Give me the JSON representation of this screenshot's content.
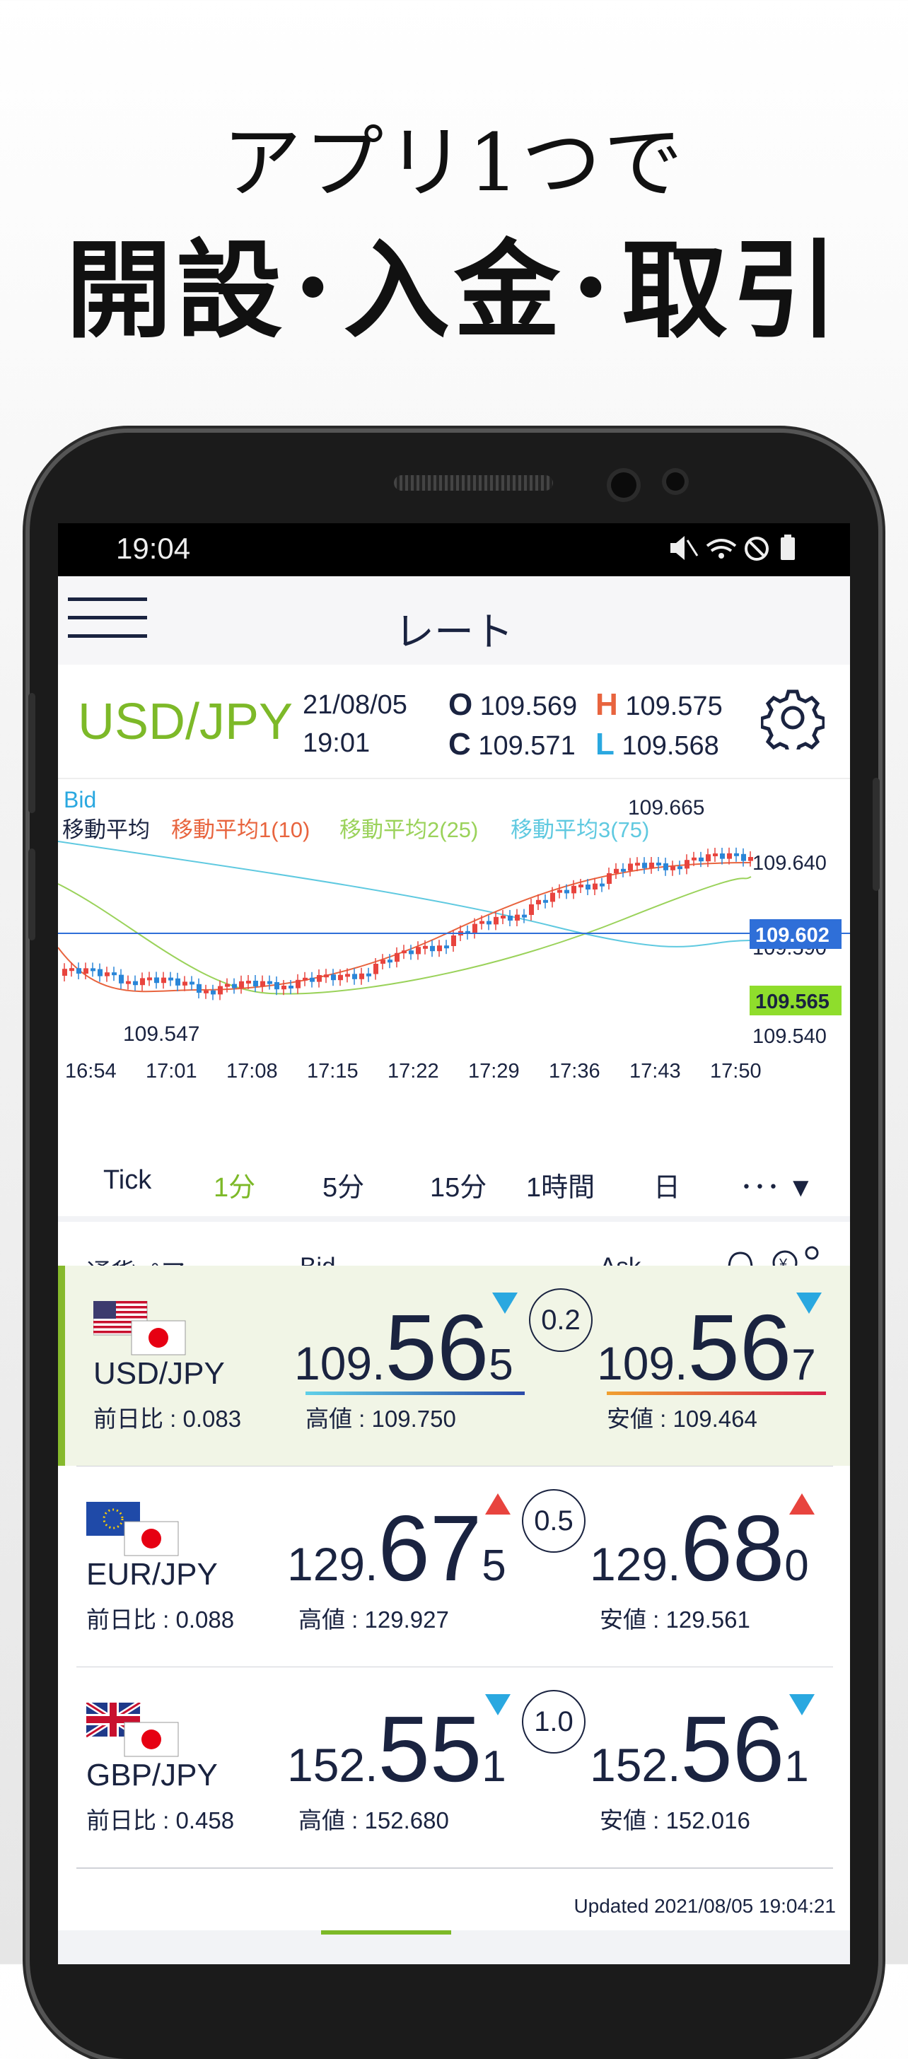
{
  "headline": {
    "line1": "アプリ1つで",
    "line2": "開設･入金･取引"
  },
  "status": {
    "time": "19:04",
    "icons": "mute-icon wifi-icon dnd-icon battery-icon"
  },
  "nav": {
    "title": "レート"
  },
  "pair_header": {
    "pair": "USD/JPY",
    "date": "21/08/05",
    "time": "19:01",
    "open_label": "O",
    "open": "109.569",
    "high_label": "H",
    "high": "109.575",
    "close_label": "C",
    "close": "109.571",
    "low_label": "L",
    "low": "109.568"
  },
  "chart_data": {
    "type": "candlestick",
    "series_label": "Bid",
    "legend": [
      "移動平均",
      "移動平均1(10)",
      "移動平均2(25)",
      "移動平均3(75)"
    ],
    "legend_colors": [
      "#1a2340",
      "#e8643e",
      "#9ad25a",
      "#5fc9e0"
    ],
    "x_ticks": [
      "16:54",
      "17:01",
      "17:08",
      "17:15",
      "17:22",
      "17:29",
      "17:36",
      "17:43",
      "17:50"
    ],
    "y_ticks": [
      "109.640",
      "109.590",
      "109.540"
    ],
    "ylim": [
      109.53,
      109.67
    ],
    "max_label": "109.665",
    "min_label": "109.547",
    "ask_line": "109.602",
    "bid_tag": "109.565"
  },
  "timeframes": [
    "Tick",
    "1分",
    "5分",
    "15分",
    "1時間",
    "日",
    "･･･ ▼"
  ],
  "list_header": {
    "pair": "通貨ペア",
    "bid": "Bid",
    "ask": "Ask"
  },
  "rows": [
    {
      "pair": "USD/JPY",
      "change": "前日比 : 0.083",
      "bid_pre": "109.",
      "bid_big": "56",
      "bid_pip": "5",
      "spread": "0.2",
      "ask_pre": "109.",
      "ask_big": "56",
      "ask_pip": "7",
      "high": "高値 : 109.750",
      "low": "安値 : 109.464",
      "bid_dir": "down",
      "ask_dir": "down"
    },
    {
      "pair": "EUR/JPY",
      "change": "前日比 : 0.088",
      "bid_pre": "129.",
      "bid_big": "67",
      "bid_pip": "5",
      "spread": "0.5",
      "ask_pre": "129.",
      "ask_big": "68",
      "ask_pip": "0",
      "high": "高値 : 129.927",
      "low": "安値 : 129.561",
      "bid_dir": "up",
      "ask_dir": "up"
    },
    {
      "pair": "GBP/JPY",
      "change": "前日比 : 0.458",
      "bid_pre": "152.",
      "bid_big": "55",
      "bid_pip": "1",
      "spread": "1.0",
      "ask_pre": "152.",
      "ask_big": "56",
      "ask_pip": "1",
      "high": "高値 : 152.680",
      "low": "安値 : 152.016",
      "bid_dir": "down",
      "ask_dir": "down"
    }
  ],
  "updated": "Updated   2021/08/05  19:04:21",
  "colors": {
    "accent": "#7db928",
    "navy": "#1a2340",
    "down": "#2aa8e0",
    "up": "#e8443e",
    "ask_line": "#2f6fd8",
    "bid_tag": "#8fdd2c"
  }
}
